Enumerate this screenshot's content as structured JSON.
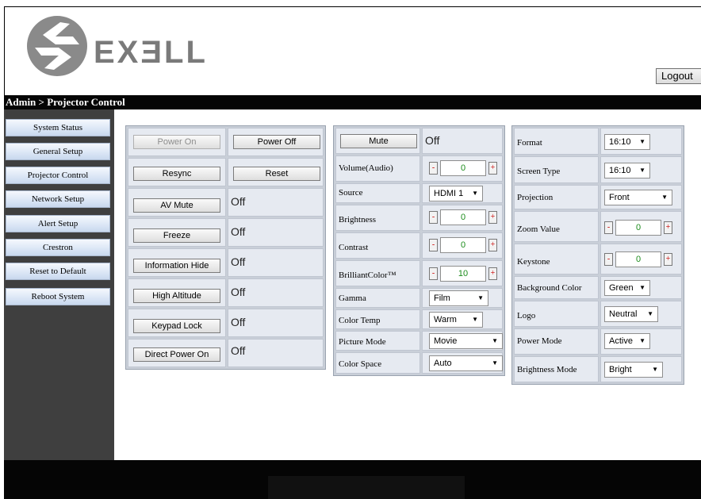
{
  "header": {
    "logo_text": "EXƎLL",
    "logout_label": "Logout"
  },
  "breadcrumb": "Admin > Projector Control",
  "sidebar": {
    "items": [
      {
        "label": "System Status"
      },
      {
        "label": "General Setup"
      },
      {
        "label": "Projector Control"
      },
      {
        "label": "Network Setup"
      },
      {
        "label": "Alert Setup"
      },
      {
        "label": "Crestron"
      },
      {
        "label": "Reset to Default"
      },
      {
        "label": "Reboot System"
      }
    ]
  },
  "power": {
    "on_label": "Power On",
    "off_label": "Power Off",
    "resync_label": "Resync",
    "reset_label": "Reset"
  },
  "toggles": [
    {
      "label": "AV Mute",
      "status": "Off"
    },
    {
      "label": "Freeze",
      "status": "Off"
    },
    {
      "label": "Information Hide",
      "status": "Off"
    },
    {
      "label": "High Altitude",
      "status": "Off"
    },
    {
      "label": "Keypad Lock",
      "status": "Off"
    },
    {
      "label": "Direct Power On",
      "status": "Off"
    }
  ],
  "audio": {
    "mute_label": "Mute",
    "mute_status": "Off",
    "volume_label": "Volume(Audio)",
    "volume_value": "0"
  },
  "image": {
    "source_label": "Source",
    "source_value": "HDMI 1",
    "brightness_label": "Brightness",
    "brightness_value": "0",
    "contrast_label": "Contrast",
    "contrast_value": "0",
    "brilliant_label": "BrilliantColor™",
    "brilliant_value": "10",
    "gamma_label": "Gamma",
    "gamma_value": "Film",
    "colortemp_label": "Color Temp",
    "colortemp_value": "Warm",
    "picturemode_label": "Picture Mode",
    "picturemode_value": "Movie",
    "colorspace_label": "Color Space",
    "colorspace_value": "Auto"
  },
  "display": {
    "format_label": "Format",
    "format_value": "16:10",
    "screentype_label": "Screen Type",
    "screentype_value": "16:10",
    "projection_label": "Projection",
    "projection_value": "Front",
    "zoom_label": "Zoom Value",
    "zoom_value": "0",
    "keystone_label": "Keystone",
    "keystone_value": "0",
    "bgcolor_label": "Background Color",
    "bgcolor_value": "Green",
    "logo_label": "Logo",
    "logo_value": "Neutral",
    "powermode_label": "Power Mode",
    "powermode_value": "Active",
    "brightmode_label": "Brightness Mode",
    "brightmode_value": "Bright"
  },
  "stepper": {
    "minus": "-",
    "plus": "+"
  },
  "colors": {
    "titlebar": "#050505",
    "sidebar": "#3f3f3f",
    "nav_button": "#dce7f6",
    "cell": "#e6eaf1",
    "value_green": "#1a8b1a"
  }
}
